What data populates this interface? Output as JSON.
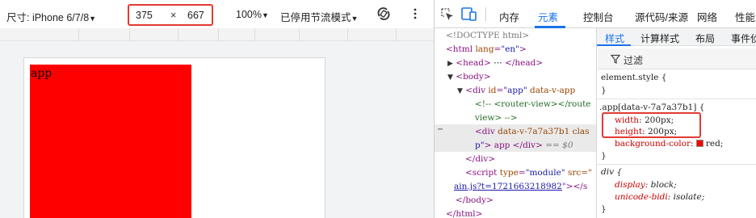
{
  "device_toolbar": {
    "device": "尺寸: iPhone 6/7/8",
    "width": "375",
    "times": "×",
    "height": "667",
    "zoom": "100%",
    "throttle": "已停用节流模式",
    "dropdown_glyph": "▼",
    "more_icon": "more-vertical-icon",
    "rotate_icon": "rotate-icon"
  },
  "viewport": {
    "app_text": "app",
    "app_color": "#ff0000"
  },
  "devtools": {
    "tabs": [
      "内存",
      "元素",
      "控制台",
      "源代码/来源",
      "网络",
      "性能"
    ],
    "active_tab": "元素",
    "accent_color": "#1a73e8"
  },
  "elements": {
    "doctype": "<!DOCTYPE html>",
    "html_open_tag": "<html ",
    "html_attr": "lang",
    "html_attr_val": "\"en\"",
    "html_close": ">",
    "head_open": "<head>",
    "head_ellipsis": "⋯",
    "head_close": "</head>",
    "body_open": "<body>",
    "div_open": "<div ",
    "div_id_attr": "id",
    "div_id_val": "\"app\"",
    "div_data_attr": "data-v-app",
    "div_close_angle": ">",
    "comment_line1": "<!-- <router-view></route",
    "comment_line2": "view> -->",
    "div2_open": "<div ",
    "div2_attr": "data-v-7a7a37b1",
    "div2_class": " clas",
    "div2_line2_val": "p\"",
    "div2_line2_text": "> app </div>",
    "div2_eq": " == $0",
    "div_end": "</div>",
    "script_open": "<script ",
    "script_type_attr": "type",
    "script_type_val": "\"module\"",
    "script_src_attr": " src=\"",
    "script_src_link": "ain.js?t=1721663218982",
    "script_end": "\"></s",
    "body_end": "</body>",
    "html_end": "</html>",
    "dots": "⋯"
  },
  "styles": {
    "tabs": [
      "样式",
      "计算样式",
      "布局",
      "事件侦"
    ],
    "active_tab": "样式",
    "filter_placeholder": "过滤",
    "element_style": "element.style {",
    "close_brace": "}",
    "rule_selector": ".app[data-v-7a7a37b1] {",
    "width_prop": "width",
    "width_val": "200px;",
    "height_prop": "height",
    "height_val": "200px;",
    "bg_prop": "background-color",
    "bg_val": "red;",
    "ua_selector": "div {",
    "display_prop": "display",
    "display_val": "block;",
    "bidi_prop": "unicode-bidi",
    "bidi_val": "isolate;"
  }
}
